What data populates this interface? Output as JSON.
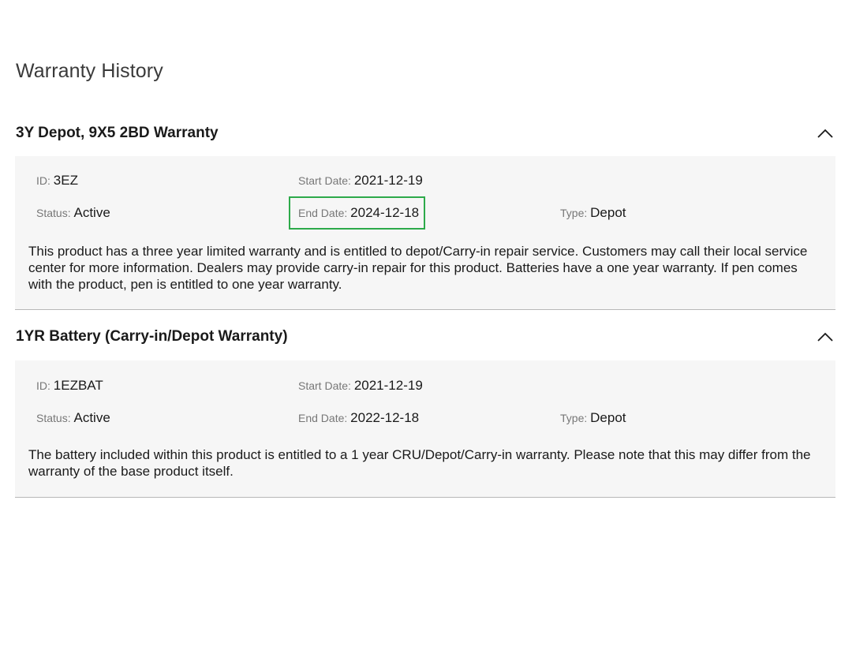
{
  "page": {
    "title": "Warranty History"
  },
  "warranties": [
    {
      "title": "3Y Depot, 9X5 2BD Warranty",
      "id_label": "ID",
      "id_value": "3EZ",
      "start_label": "Start Date",
      "start_value": "2021-12-19",
      "status_label": "Status",
      "status_value": "Active",
      "end_label": "End Date",
      "end_value": "2024-12-18",
      "type_label": "Type",
      "type_value": "Depot",
      "description": "This product has a three year limited warranty and is entitled to depot/Carry-in repair service. Customers may call their local service center for more information. Dealers may provide carry-in repair for this product. Batteries have a one year warranty. If pen comes with the product, pen is entitled to one year warranty.",
      "end_highlighted": true,
      "expanded": true,
      "chevron_icon": "chevron-up-icon"
    },
    {
      "title": "1YR Battery (Carry-in/Depot Warranty)",
      "id_label": "ID",
      "id_value": "1EZBAT",
      "start_label": "Start Date",
      "start_value": "2021-12-19",
      "status_label": "Status",
      "status_value": "Active",
      "end_label": "End Date",
      "end_value": "2022-12-18",
      "type_label": "Type",
      "type_value": "Depot",
      "description": "The battery included within this product is entitled to a 1 year CRU/Depot/Carry-in warranty. Please note that this may differ from the warranty of the base product itself.",
      "end_highlighted": false,
      "expanded": true,
      "chevron_icon": "chevron-up-icon"
    }
  ],
  "colors": {
    "highlight": "#2daa4a",
    "card_background": "#f6f6f6",
    "label": "#777777"
  }
}
